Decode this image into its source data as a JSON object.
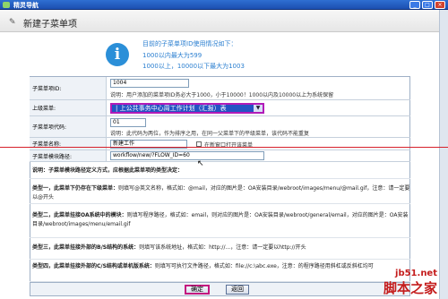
{
  "window": {
    "title": "精灵导航"
  },
  "header": {
    "title": "新建子菜单项"
  },
  "banner": {
    "line1": "目前的子菜单项ID使用情况如下：",
    "line2": "1000以内最大为599",
    "line3": "1000以上，10000以下最大为1003"
  },
  "form": {
    "id": {
      "label": "子菜单项ID:",
      "value": "1004",
      "note": "说明：用户添加的菜单项ID务必大于1000，小于10000！1000以内及10000以上为系统保留"
    },
    "parent": {
      "label": "上级菜单:",
      "selected": "| 上公共事务中心周工作计划（汇报）表"
    },
    "code": {
      "label": "子菜单项代码:",
      "value": "01",
      "note": "说明：此代码为两位，作为排序之用，在同一父菜单下的平级菜单，该代码不能重复"
    },
    "name": {
      "label": "子菜单名称:",
      "value": "新建工作",
      "checkbox_label": "在新窗口打开该菜单"
    },
    "path": {
      "label": "子菜单模块路径:",
      "value": "workflow/new/?FLOW_ID=60"
    }
  },
  "explanation": {
    "intro": "说明：子菜单模块路径定义方式，应根据此菜单项的类型决定：",
    "type1_head": "类型一，此菜单下仍存在下级菜单：",
    "type1_text": "则填写@英文名称，格式如：@mail，对应的图片是：OA安装目录/webroot/images/menu/@mail.gif，注意：请一定要以@开头",
    "type2_head": "类型二，此菜单挂接OA系统中的模块：",
    "type2_text": "则填写程序路径，格式如：email，则对应的图片是：OA安装目录/webroot/general/email，对应的图片是：OA安装目录/webroot/images/menu/email.gif",
    "type3_head": "类型三，此菜单挂接外部的B/S结构的系统：",
    "type3_text": "则填写该系统地址，格式如：http://...，注意：请一定要以http://开头",
    "type4_head": "类型四，此菜单挂接外部的C/S结构或单机版系统：",
    "type4_text": "则填写可执行文件路径，格式如：file://c:\\abc.exe，注意：的程序路径用斜杠或反斜杠均可"
  },
  "buttons": {
    "ok": "确定",
    "back": "返回"
  },
  "watermark": {
    "site": "jb51.net",
    "brand": "脚本之家"
  }
}
